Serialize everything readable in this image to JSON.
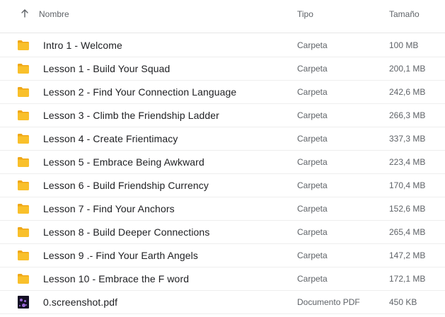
{
  "header": {
    "sort_icon": "arrow-up-icon",
    "name_label": "Nombre",
    "type_label": "Tipo",
    "size_label": "Tamaño"
  },
  "colors": {
    "folder": "#F9C02B",
    "folder_tab": "#F0A818",
    "pdf_thumb": "#141024"
  },
  "files": [
    {
      "name": "Intro 1 - Welcome",
      "type": "Carpeta",
      "size": "100 MB",
      "icon": "folder-icon"
    },
    {
      "name": "Lesson 1 - Build Your Squad",
      "type": "Carpeta",
      "size": "200,1 MB",
      "icon": "folder-icon"
    },
    {
      "name": "Lesson 2 - Find Your Connection Language",
      "type": "Carpeta",
      "size": "242,6 MB",
      "icon": "folder-icon"
    },
    {
      "name": "Lesson 3 - Climb the Friendship Ladder",
      "type": "Carpeta",
      "size": "266,3 MB",
      "icon": "folder-icon"
    },
    {
      "name": "Lesson 4 - Create Frientimacy",
      "type": "Carpeta",
      "size": "337,3 MB",
      "icon": "folder-icon"
    },
    {
      "name": "Lesson 5 - Embrace Being Awkward",
      "type": "Carpeta",
      "size": "223,4 MB",
      "icon": "folder-icon"
    },
    {
      "name": "Lesson 6 - Build Friendship Currency",
      "type": "Carpeta",
      "size": "170,4 MB",
      "icon": "folder-icon"
    },
    {
      "name": "Lesson 7 - Find Your Anchors",
      "type": "Carpeta",
      "size": "152,6 MB",
      "icon": "folder-icon"
    },
    {
      "name": "Lesson 8 - Build Deeper Connections",
      "type": "Carpeta",
      "size": "265,4 MB",
      "icon": "folder-icon"
    },
    {
      "name": "Lesson 9 .- Find Your Earth Angels",
      "type": "Carpeta",
      "size": "147,2 MB",
      "icon": "folder-icon"
    },
    {
      "name": "Lesson 10 - Embrace the F word",
      "type": "Carpeta",
      "size": "172,1 MB",
      "icon": "folder-icon"
    },
    {
      "name": "0.screenshot.pdf",
      "type": "Documento PDF",
      "size": "450 KB",
      "icon": "pdf-thumbnail-icon"
    }
  ]
}
